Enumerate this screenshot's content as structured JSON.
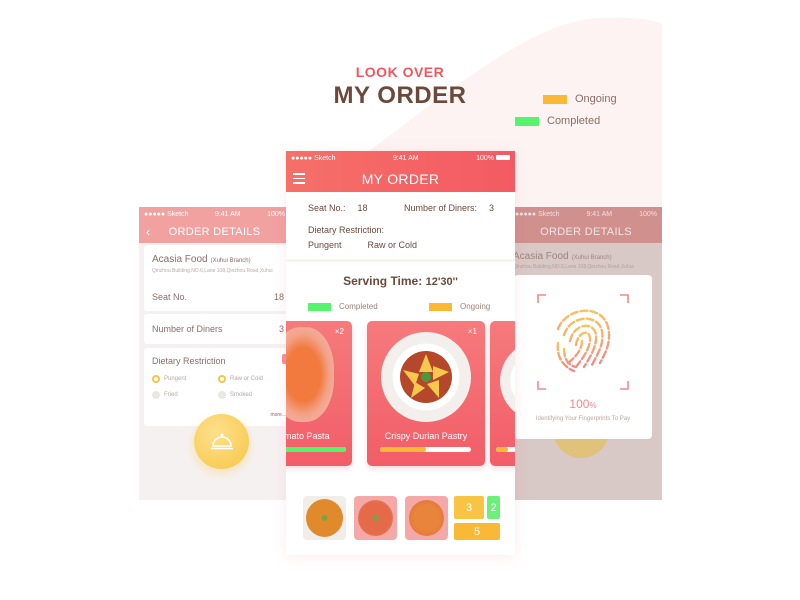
{
  "hero": {
    "subtitle": "LOOK OVER",
    "title": "MY ORDER"
  },
  "legend": [
    {
      "label": "Ongoing",
      "color": "#f9b934"
    },
    {
      "label": "Completed",
      "color": "#55f46c"
    }
  ],
  "status_bar": {
    "carrier": "●●●●● Sketch",
    "time": "9:41 AM",
    "battery": "100%"
  },
  "left_screen": {
    "nav_title": "ORDER DETAILS",
    "back_icon": "‹",
    "restaurant": {
      "name": "Acasia Food",
      "branch": "(Xuhui Branch)",
      "address": "Qinzhou Building,NO.6,Lane 108,Qinzhou Road,Xuhui"
    },
    "seat_label": "Seat No.",
    "seat_value": "18",
    "diners_label": "Number of Diners",
    "diners_value": "3",
    "dietary_label": "Dietary Restriction",
    "options": [
      {
        "label": "Pungent",
        "selected": true
      },
      {
        "label": "Raw or Cold",
        "selected": true
      },
      {
        "label": "Fried",
        "selected": false
      },
      {
        "label": "Smoked",
        "selected": false
      }
    ],
    "more_label": "more...",
    "check_icon": "✓"
  },
  "center_screen": {
    "nav_title": "MY ORDER",
    "seat_label": "Seat No.:",
    "seat_value": "18",
    "diners_label": "Number of Diners:",
    "diners_value": "3",
    "dietary_label": "Dietary Restriction:",
    "dietary_values": [
      "Pungent",
      "Raw or Cold"
    ],
    "serving_label": "Serving Time:",
    "serving_time": "12'30''",
    "legend": [
      {
        "label": "Completed",
        "color": "#55f46c"
      },
      {
        "label": "Ongoing",
        "color": "#f9b934"
      }
    ],
    "dishes": [
      {
        "name": "Tomato Pasta",
        "visible_name": "mato Pasta",
        "qty": "×2",
        "progress": 1.0,
        "status": "completed"
      },
      {
        "name": "Crispy Durian Pastry",
        "visible_name": "Crispy Durian Pastry",
        "qty": "×1",
        "progress": 0.5,
        "status": "ongoing"
      },
      {
        "name": "",
        "visible_name": "",
        "qty": "",
        "progress": 0.3,
        "status": "ongoing"
      }
    ],
    "summary_tiles": [
      {
        "value": "3",
        "color": "#f9c443"
      },
      {
        "value": "2",
        "color": "#6cf07a"
      },
      {
        "value": "5",
        "color": "#f9b934"
      }
    ]
  },
  "right_screen": {
    "nav_title": "ORDER DETAILS",
    "restaurant": {
      "name": "Acasia Food",
      "branch": "(Xuhui Branch)",
      "address": "Qinzhou Building,NO.6,Lane 108,Qinzhou Road,Xuhui"
    },
    "fingerprint_percent": "100",
    "percent_sign": "%",
    "fingerprint_message": "Identifying Your Fingerprints To Pay"
  }
}
